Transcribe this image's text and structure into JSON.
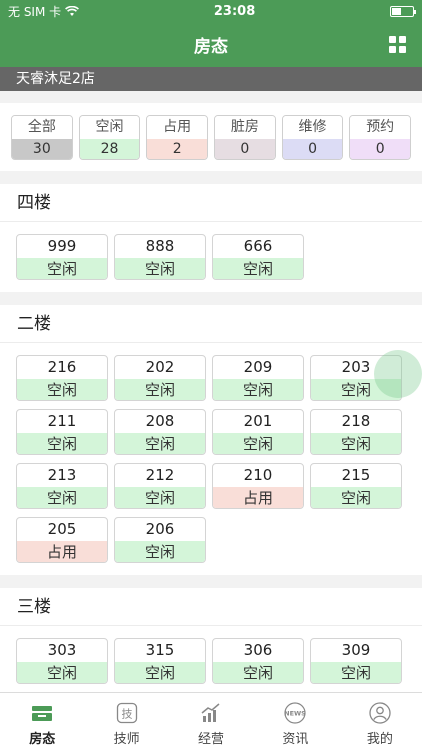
{
  "status_bar": {
    "carrier": "无 SIM 卡",
    "time": "23:08"
  },
  "nav": {
    "title": "房态"
  },
  "store_name": "天睿沐足2店",
  "filters": [
    {
      "label": "全部",
      "count": "30",
      "color": "#c8c8c8"
    },
    {
      "label": "空闲",
      "count": "28",
      "color": "#d4f5d9"
    },
    {
      "label": "占用",
      "count": "2",
      "color": "#f9ded8"
    },
    {
      "label": "脏房",
      "count": "0",
      "color": "#e6dde2"
    },
    {
      "label": "维修",
      "count": "0",
      "color": "#dcdcf5"
    },
    {
      "label": "预约",
      "count": "0",
      "color": "#f0def8"
    }
  ],
  "floors": [
    {
      "name": "四楼",
      "rooms": [
        {
          "number": "999",
          "status": "空闲"
        },
        {
          "number": "888",
          "status": "空闲"
        },
        {
          "number": "666",
          "status": "空闲"
        }
      ]
    },
    {
      "name": "二楼",
      "rooms": [
        {
          "number": "216",
          "status": "空闲"
        },
        {
          "number": "202",
          "status": "空闲"
        },
        {
          "number": "209",
          "status": "空闲"
        },
        {
          "number": "203",
          "status": "空闲"
        },
        {
          "number": "211",
          "status": "空闲"
        },
        {
          "number": "208",
          "status": "空闲"
        },
        {
          "number": "201",
          "status": "空闲"
        },
        {
          "number": "218",
          "status": "空闲"
        },
        {
          "number": "213",
          "status": "空闲"
        },
        {
          "number": "212",
          "status": "空闲"
        },
        {
          "number": "210",
          "status": "占用"
        },
        {
          "number": "215",
          "status": "空闲"
        },
        {
          "number": "205",
          "status": "占用"
        },
        {
          "number": "206",
          "status": "空闲"
        }
      ]
    },
    {
      "name": "三楼",
      "rooms": [
        {
          "number": "303",
          "status": "空闲"
        },
        {
          "number": "315",
          "status": "空闲"
        },
        {
          "number": "306",
          "status": "空闲"
        },
        {
          "number": "309",
          "status": "空闲"
        },
        {
          "number": "",
          "status": ""
        },
        {
          "number": "",
          "status": ""
        },
        {
          "number": "",
          "status": ""
        },
        {
          "number": "",
          "status": ""
        }
      ]
    }
  ],
  "tabs": [
    {
      "label": "房态",
      "icon": "room-icon",
      "active": true
    },
    {
      "label": "技师",
      "icon": "technician-icon",
      "active": false
    },
    {
      "label": "经营",
      "icon": "business-chart-icon",
      "active": false
    },
    {
      "label": "资讯",
      "icon": "news-icon",
      "active": false
    },
    {
      "label": "我的",
      "icon": "profile-icon",
      "active": false
    }
  ],
  "colors": {
    "brand": "#4c9b57",
    "free": "#d4f5d9",
    "busy": "#f9ded8"
  }
}
